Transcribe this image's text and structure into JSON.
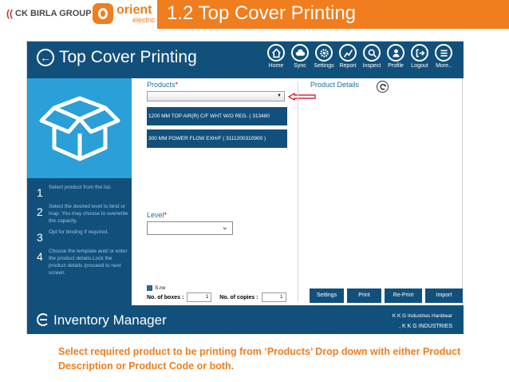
{
  "slide": {
    "ck_logo": "CK BIRLA GROUP",
    "orient_name": "orient",
    "orient_sub": "electric",
    "title": "1.2  Top Cover Printing",
    "caption": "Select required product to be printing from ‘Products’ Drop down with either Product Description or Product Code or both."
  },
  "app": {
    "title": "Top Cover Printing",
    "nav": [
      {
        "label": "Home",
        "icon": "home-icon"
      },
      {
        "label": "Sync",
        "icon": "cloud-sync-icon"
      },
      {
        "label": "Settings",
        "icon": "gear-icon"
      },
      {
        "label": "Report",
        "icon": "chart-icon"
      },
      {
        "label": "Inspect",
        "icon": "search-icon"
      },
      {
        "label": "Profile",
        "icon": "profile-icon"
      },
      {
        "label": "Logout",
        "icon": "logout-icon"
      },
      {
        "label": "More..",
        "icon": "menu-icon"
      }
    ],
    "steps": [
      {
        "num": "1",
        "text": "Select product from the list."
      },
      {
        "num": "2",
        "text": "Select the desired level to bind or map. You may choose to overwrite the capacity."
      },
      {
        "num": "3",
        "text": "Opt for binding if required."
      },
      {
        "num": "4",
        "text": "Choose the template and/ or enter the product details.Lock the product details /proceed to next screen."
      }
    ],
    "products_label": "Products",
    "product_options": [
      "1200 MM TOP AIR(R) C/F WHT W/O REG. ( 313480",
      "300 MM POWER FLOW EXH/F ( 3111200310900 )"
    ],
    "product_details_label": "Product Details",
    "level_label": "Level",
    "sno_label": "S.no",
    "boxes_label": "No. of boxes :",
    "boxes_value": "1",
    "copies_label": "No. of copies :",
    "copies_value": "1",
    "buttons": {
      "settings": "Settings",
      "print": "Print",
      "reprint": "Re-Print",
      "import": "Import"
    },
    "footer_title": "Inventory Manager",
    "footer_company": "K K G Industries Haridwar",
    "footer_company2": ", K K G INDUSTRIES"
  },
  "colors": {
    "brand_orange": "#f07d1e",
    "app_navy": "#12507c",
    "hero_blue": "#2a9fd8",
    "label_blue": "#1a6fa8",
    "arrow_red": "#d0021b"
  }
}
